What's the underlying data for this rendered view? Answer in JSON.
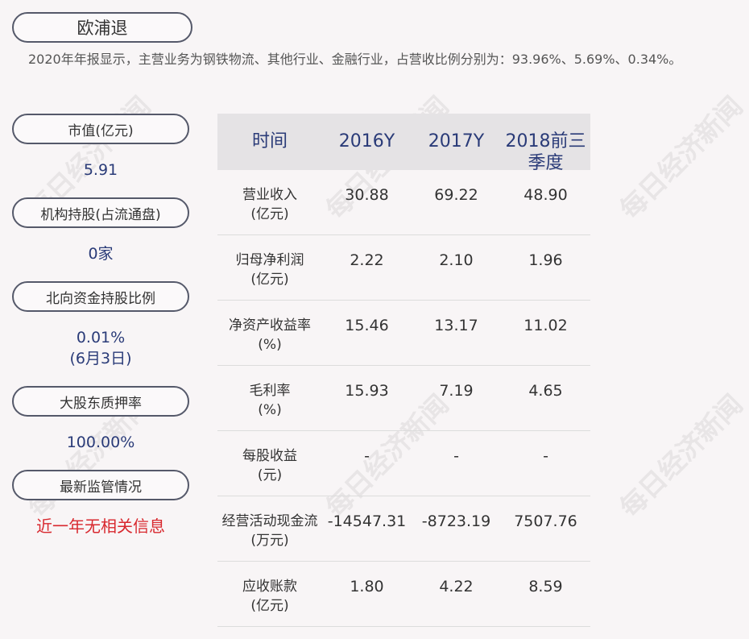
{
  "header": {
    "company": "欧浦退",
    "summary": "2020年年报显示，主营业务为钢铁物流、其他行业、金融行业，占营收比例分别为：93.96%、5.69%、0.34%。"
  },
  "left_panel": {
    "market_cap_label": "市值(亿元)",
    "market_cap_value": "5.91",
    "institution_label": "机构持股(占流通盘)",
    "institution_value": "0家",
    "northbound_label": "北向资金持股比例",
    "northbound_value": "0.01%",
    "northbound_date": "(6月3日)",
    "pledge_label": "大股东质押率",
    "pledge_value": "100.00%",
    "regulation_label": "最新监管情况",
    "regulation_value": "近一年无相关信息"
  },
  "table": {
    "headers": [
      "时间",
      "2016Y",
      "2017Y",
      "2018前三季度"
    ],
    "rows": [
      {
        "label": "营业收入",
        "unit": "(亿元)",
        "values": [
          "30.88",
          "69.22",
          "48.90"
        ]
      },
      {
        "label": "归母净利润",
        "unit": "(亿元)",
        "values": [
          "2.22",
          "2.10",
          "1.96"
        ]
      },
      {
        "label": "净资产收益率",
        "unit": "(%)",
        "values": [
          "15.46",
          "13.17",
          "11.02"
        ]
      },
      {
        "label": "毛利率",
        "unit": "(%)",
        "values": [
          "15.93",
          "7.19",
          "4.65"
        ]
      },
      {
        "label": "每股收益",
        "unit": "(元)",
        "values": [
          "-",
          "-",
          "-"
        ]
      },
      {
        "label": "经营活动现金流",
        "unit": "(万元)",
        "values": [
          "-14547.31",
          "-8723.19",
          "7507.76"
        ]
      },
      {
        "label": "应收账款",
        "unit": "(亿元)",
        "values": [
          "1.80",
          "4.22",
          "8.59"
        ]
      }
    ]
  },
  "watermark": "每日经济新闻"
}
